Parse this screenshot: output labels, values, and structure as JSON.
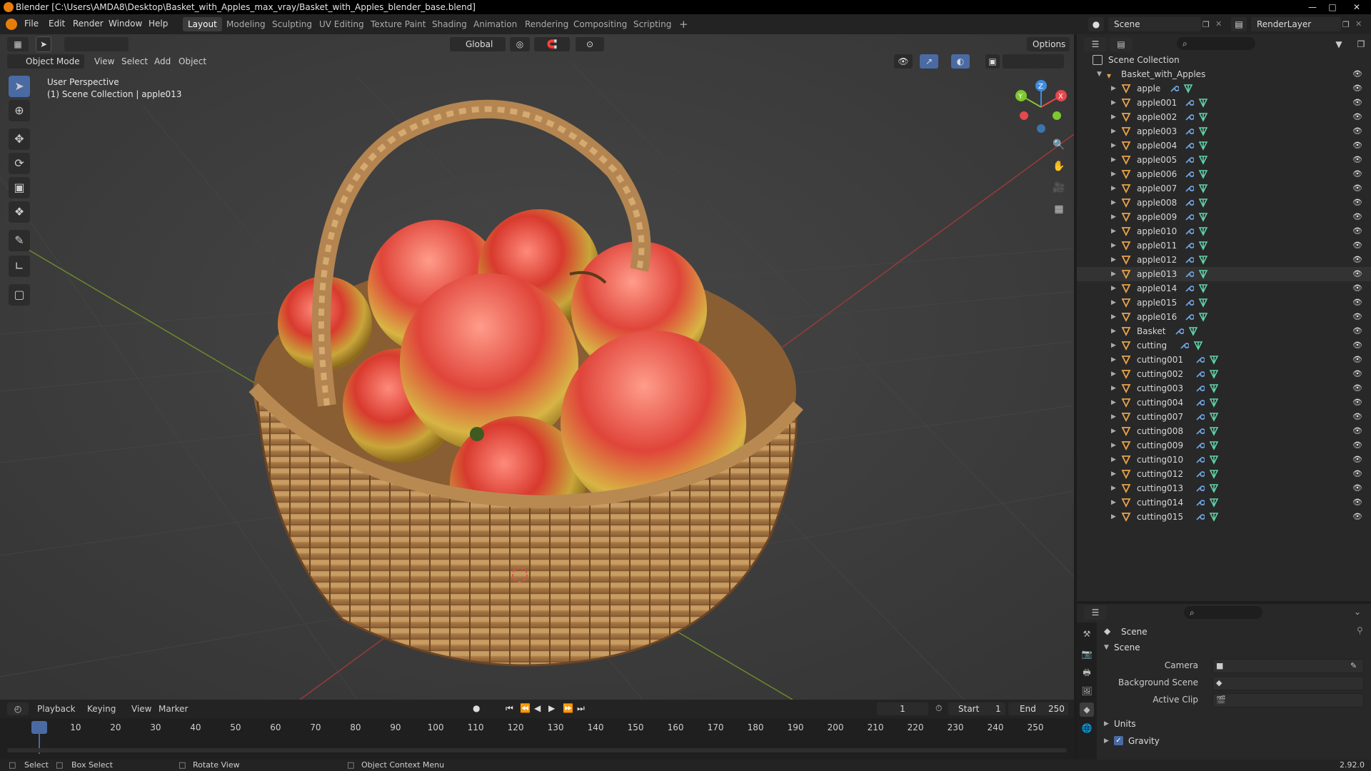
{
  "window": {
    "title": "Blender [C:\\Users\\AMDA8\\Desktop\\Basket_with_Apples_max_vray/Basket_with_Apples_blender_base.blend]"
  },
  "menu": [
    "File",
    "Edit",
    "Render",
    "Window",
    "Help"
  ],
  "workspaces": [
    {
      "label": "Layout",
      "active": true
    },
    {
      "label": "Modeling"
    },
    {
      "label": "Sculpting"
    },
    {
      "label": "UV Editing"
    },
    {
      "label": "Texture Paint"
    },
    {
      "label": "Shading"
    },
    {
      "label": "Animation"
    },
    {
      "label": "Rendering"
    },
    {
      "label": "Compositing"
    },
    {
      "label": "Scripting"
    }
  ],
  "scene_selector": "Scene",
  "render_layer": "RenderLayer",
  "viewport": {
    "mode": "Object Mode",
    "menus": [
      "View",
      "Select",
      "Add",
      "Object"
    ],
    "transform_orientation": "Global",
    "options_label": "Options",
    "overlay_line1": "User Perspective",
    "overlay_line2": "(1) Scene Collection | apple013",
    "gizmo_axes": [
      "X",
      "Y",
      "Z"
    ]
  },
  "outliner": {
    "root": "Scene Collection",
    "collection": "Basket_with_Apples",
    "selected": "apple013",
    "items": [
      "apple",
      "apple001",
      "apple002",
      "apple003",
      "apple004",
      "apple005",
      "apple006",
      "apple007",
      "apple008",
      "apple009",
      "apple010",
      "apple011",
      "apple012",
      "apple013",
      "apple014",
      "apple015",
      "apple016",
      "Basket",
      "cutting",
      "cutting001",
      "cutting002",
      "cutting003",
      "cutting004",
      "cutting007",
      "cutting008",
      "cutting009",
      "cutting010",
      "cutting012",
      "cutting013",
      "cutting014",
      "cutting015"
    ]
  },
  "properties": {
    "context": "Scene",
    "panel": "Scene",
    "camera_label": "Camera",
    "background_scene_label": "Background Scene",
    "active_clip_label": "Active Clip",
    "units_label": "Units",
    "gravity_label": "Gravity",
    "gravity_checked": true
  },
  "timeline": {
    "menus": [
      "Playback",
      "Keying",
      "View",
      "Marker"
    ],
    "current_frame": "1",
    "start_label": "Start",
    "start": "1",
    "end_label": "End",
    "end": "250",
    "ticks": [
      "1",
      "10",
      "20",
      "30",
      "40",
      "50",
      "60",
      "70",
      "80",
      "90",
      "100",
      "110",
      "120",
      "130",
      "140",
      "150",
      "160",
      "170",
      "180",
      "190",
      "200",
      "210",
      "220",
      "230",
      "240",
      "250"
    ]
  },
  "status": {
    "select": "Select",
    "box_select": "Box Select",
    "rotate_view": "Rotate View",
    "context_menu": "Object Context Menu",
    "version": "2.92.0"
  },
  "colors": {
    "accent": "#4a6aa3",
    "object_icon": "#e8a34a",
    "mesh_icon": "#5fd1a6",
    "modifier_icon": "#6ea3e0",
    "x_axis": "#e5484d",
    "y_axis": "#7fc72f",
    "z_axis": "#3e8ddf"
  }
}
